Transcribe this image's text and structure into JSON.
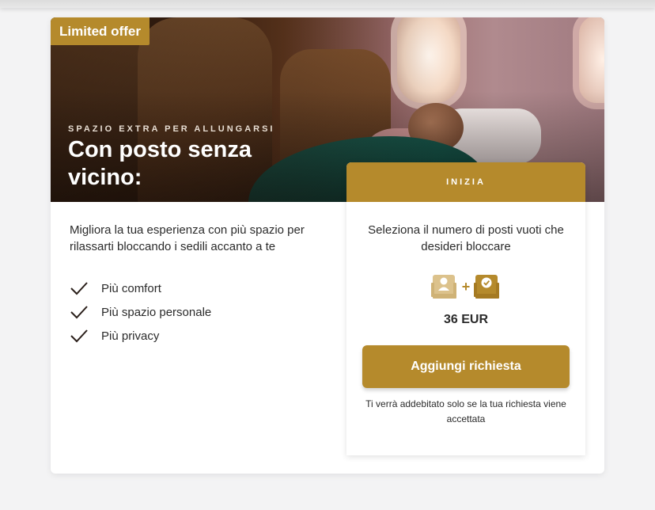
{
  "badge": "Limited offer",
  "hero": {
    "eyebrow": "SPAZIO EXTRA PER ALLUNGARSI",
    "title": "Con posto senza vicino:"
  },
  "description": "Migliora la tua esperienza con più spazio per rilassarti bloccando i sedili accanto a te",
  "features": [
    "Più comfort",
    "Più spazio personale",
    "Più privacy"
  ],
  "panel": {
    "heading": "INIZIA",
    "description": "Seleziona il numero di posti vuoti che desideri bloccare",
    "icons": [
      "seat-passenger-icon",
      "plus-icon",
      "seat-blocked-check-icon"
    ],
    "plus": "+",
    "price": "36 EUR",
    "button_label": "Aggiungi richiesta",
    "note": "Ti verrà addebitato solo se la tua richiesta viene accettata"
  },
  "colors": {
    "accent": "#b58a2c",
    "icon_light": "#d9c08a"
  }
}
